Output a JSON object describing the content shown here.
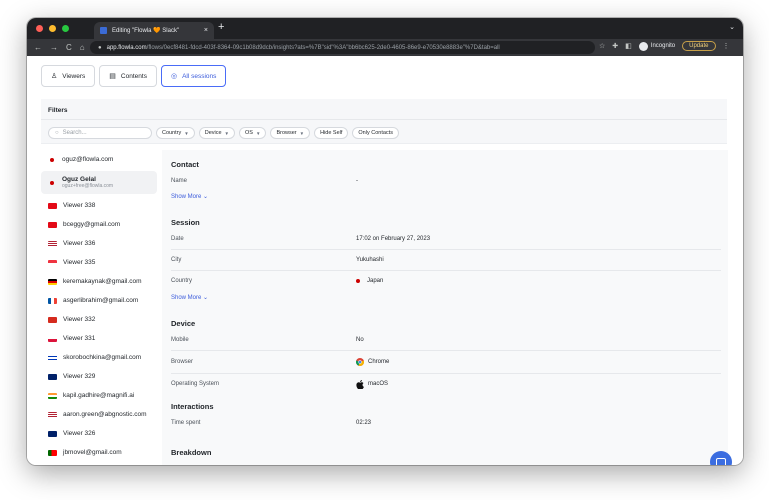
{
  "browser": {
    "tab_title": "Editing \"Flowla 🧡 Slack\"",
    "tab_close": "×",
    "new_tab": "+",
    "tab_menu": "⌄",
    "back": "←",
    "forward": "→",
    "reload": "C",
    "home": "⌂",
    "url_host": "app.flowla.com",
    "url_path": "/flows/0ecf8481-fdcd-403f-8364-09c1b08d9dcb/insights?ats=%7B\"sid\"%3A\"bb6bc625-2de0-4605-86e9-e70530e8883e\"%7D&tab=all",
    "star": "☆",
    "extensions": "✚",
    "sidepanel": "◧",
    "incognito_label": "Incognito",
    "update_label": "Update",
    "menu": "⋮"
  },
  "view_tabs": [
    {
      "label": "Viewers",
      "icon": "viewers-icon",
      "active": false
    },
    {
      "label": "Contents",
      "icon": "contents-icon",
      "active": false
    },
    {
      "label": "All sessions",
      "icon": "eye-icon",
      "active": true
    }
  ],
  "filters": {
    "title": "Filters",
    "search_placeholder": "Search...",
    "chips": [
      "Country",
      "Device",
      "OS",
      "Browser",
      "Hide Self",
      "Only Contacts"
    ]
  },
  "sidebar": {
    "items": [
      {
        "label": "oguz@flowla.com",
        "sub": "",
        "flag": "jp"
      },
      {
        "label": "Oguz Gelal",
        "sub": "oguz+free@flowla.com",
        "flag": "jp"
      },
      {
        "label": "Viewer 338",
        "sub": "",
        "flag": "tr"
      },
      {
        "label": "bceggy@gmail.com",
        "sub": "",
        "flag": "tr"
      },
      {
        "label": "Viewer 336",
        "sub": "",
        "flag": "us"
      },
      {
        "label": "Viewer 335",
        "sub": "",
        "flag": "sg"
      },
      {
        "label": "keremakaynak@gmail.com",
        "sub": "",
        "flag": "de"
      },
      {
        "label": "asgerlibrahim@gmail.com",
        "sub": "",
        "flag": "fr"
      },
      {
        "label": "Viewer 332",
        "sub": "",
        "flag": "ch"
      },
      {
        "label": "Viewer 331",
        "sub": "",
        "flag": "pl"
      },
      {
        "label": "skorobochkina@gmail.com",
        "sub": "",
        "flag": "il"
      },
      {
        "label": "Viewer 329",
        "sub": "",
        "flag": "gb"
      },
      {
        "label": "kapil.gadhire@magnifi.ai",
        "sub": "",
        "flag": "in"
      },
      {
        "label": "aaron.green@abgnostic.com",
        "sub": "",
        "flag": "us"
      },
      {
        "label": "Viewer 326",
        "sub": "",
        "flag": "gb"
      },
      {
        "label": "jbmovel@gmail.com",
        "sub": "",
        "flag": "pt"
      }
    ]
  },
  "details": {
    "contact": {
      "title": "Contact",
      "name_label": "Name",
      "name_value": "-",
      "show_more": "Show More ⌄"
    },
    "session": {
      "title": "Session",
      "date_label": "Date",
      "date_value": "17:02 on February 27, 2023",
      "city_label": "City",
      "city_value": "Yukuhashi",
      "country_label": "Country",
      "country_value": "Japan",
      "show_more": "Show More ⌄"
    },
    "device": {
      "title": "Device",
      "mobile_label": "Mobile",
      "mobile_value": "No",
      "browser_label": "Browser",
      "browser_value": "Chrome",
      "os_label": "Operating System",
      "os_value": "macOS"
    },
    "interactions": {
      "title": "Interactions",
      "time_label": "Time spent",
      "time_value": "02:23"
    },
    "breakdown": {
      "title": "Breakdown"
    }
  },
  "colors": {
    "accent": "#3b5bdb",
    "chat": "#3b6de0"
  }
}
